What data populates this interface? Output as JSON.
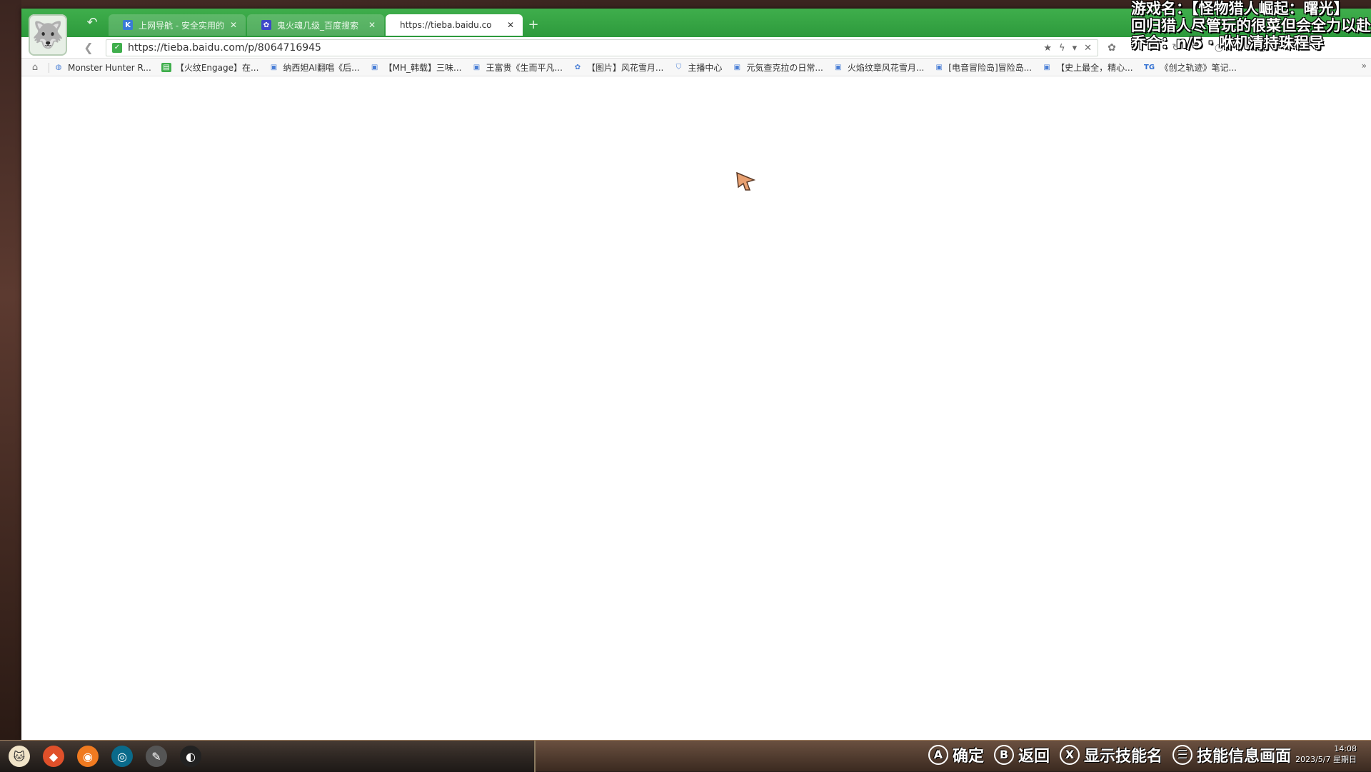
{
  "browser": {
    "tabs": [
      {
        "label": "上网导航 - 安全实用的",
        "icon": "K",
        "active": false
      },
      {
        "label": "鬼火魂几级_百度搜索",
        "icon": "paw",
        "active": false
      },
      {
        "label": "https://tieba.baidu.co",
        "icon": "",
        "active": true
      }
    ],
    "new_tab": "+",
    "url": "https://tieba.baidu.com/p/8064716945",
    "bookmarks": [
      {
        "label": "Monster Hunter R...",
        "icon": "globe"
      },
      {
        "label": "【火纹Engage】在...",
        "icon": "green"
      },
      {
        "label": "纳西妲AI翻唱《后...",
        "icon": "bilibili"
      },
      {
        "label": "【MH_韩载】三味...",
        "icon": "bilibili"
      },
      {
        "label": "王富贵《生而平凡...",
        "icon": "bilibili"
      },
      {
        "label": "【图片】风花雪月...",
        "icon": "paw"
      },
      {
        "label": "主播中心",
        "icon": "shield"
      },
      {
        "label": "元気查克拉の日常...",
        "icon": "bilibili"
      },
      {
        "label": "火焰纹章风花雪月...",
        "icon": "bilibili"
      },
      {
        "label": "[电音冒险岛]冒险岛...",
        "icon": "bilibili"
      },
      {
        "label": "【史上最全，精心...",
        "icon": "bilibili"
      },
      {
        "label": "《创之轨迹》笔记...",
        "icon": "TG"
      }
    ],
    "bookmarks_more": "»"
  },
  "overlay": {
    "line1": "游戏名：【怪物猎人崛起：曙光】",
    "line2": "回归猎人尽管玩的很菜但会全力以赴",
    "line3": "乔合：n/5 · 咻机清持珠程导"
  },
  "taskbar": {
    "hints": [
      {
        "button": "A",
        "label": "确定"
      },
      {
        "button": "B",
        "label": "返回"
      },
      {
        "button": "X",
        "label": "显示技能名"
      },
      {
        "button": "☰",
        "label": "技能信息画面"
      }
    ],
    "clock_time": "14:08",
    "clock_date": "2023/5/7 星期日"
  },
  "colors": {
    "browser_green": "#3fae4c",
    "cursor_fill": "#e8a070"
  }
}
